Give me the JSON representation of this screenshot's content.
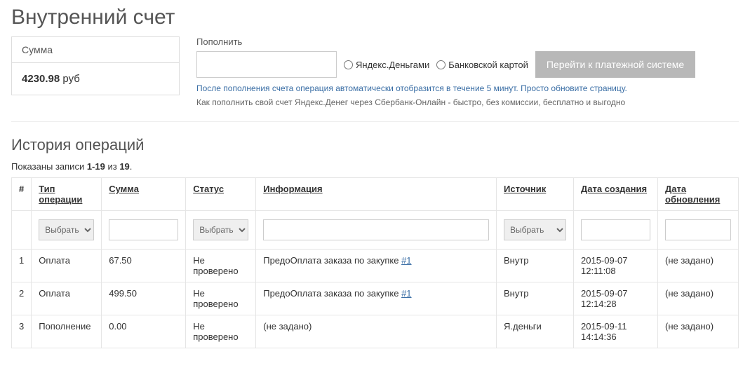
{
  "page_title": "Внутренний счет",
  "balance": {
    "label": "Сумма",
    "value": "4230.98",
    "currency": "руб"
  },
  "topup": {
    "title": "Пополнить",
    "option_yandex": "Яндекс.Деньгами",
    "option_card": "Банковской картой",
    "button": "Перейти к платежной системе",
    "hint1": "После пополнения счета операция автоматически отобразится в течение 5 минут. Просто обновите страницу.",
    "hint2": "Как пополнить свой счет Яндекс.Денег через Сбербанк-Онлайн - быстро, без комиссии, бесплатно и выгодно"
  },
  "history": {
    "title": "История операций",
    "records_text_prefix": "Показаны записи ",
    "records_range": "1-19",
    "records_text_mid": " из ",
    "records_total": "19",
    "records_text_suffix": ".",
    "headers": {
      "idx": "#",
      "type": "Тип операции",
      "sum": "Сумма",
      "status": "Статус",
      "info": "Информация",
      "source": "Источник",
      "created": "Дата создания",
      "updated": "Дата обновления"
    },
    "filter_placeholder_select": "Выбрать",
    "rows": [
      {
        "idx": "1",
        "type": "Оплата",
        "sum": "67.50",
        "status": "Не проверено",
        "info_prefix": "ПредоОплата заказа по закупке ",
        "info_link": "#1",
        "source": "Внутр",
        "created": "2015-09-07 12:11:08",
        "updated": "(не задано)"
      },
      {
        "idx": "2",
        "type": "Оплата",
        "sum": "499.50",
        "status": "Не проверено",
        "info_prefix": "ПредоОплата заказа по закупке ",
        "info_link": "#1",
        "source": "Внутр",
        "created": "2015-09-07 12:14:28",
        "updated": "(не задано)"
      },
      {
        "idx": "3",
        "type": "Пополнение",
        "sum": "0.00",
        "status": "Не проверено",
        "info_plain": "(не задано)",
        "source": "Я.деньги",
        "created": "2015-09-11 14:14:36",
        "updated": "(не задано)"
      }
    ]
  }
}
